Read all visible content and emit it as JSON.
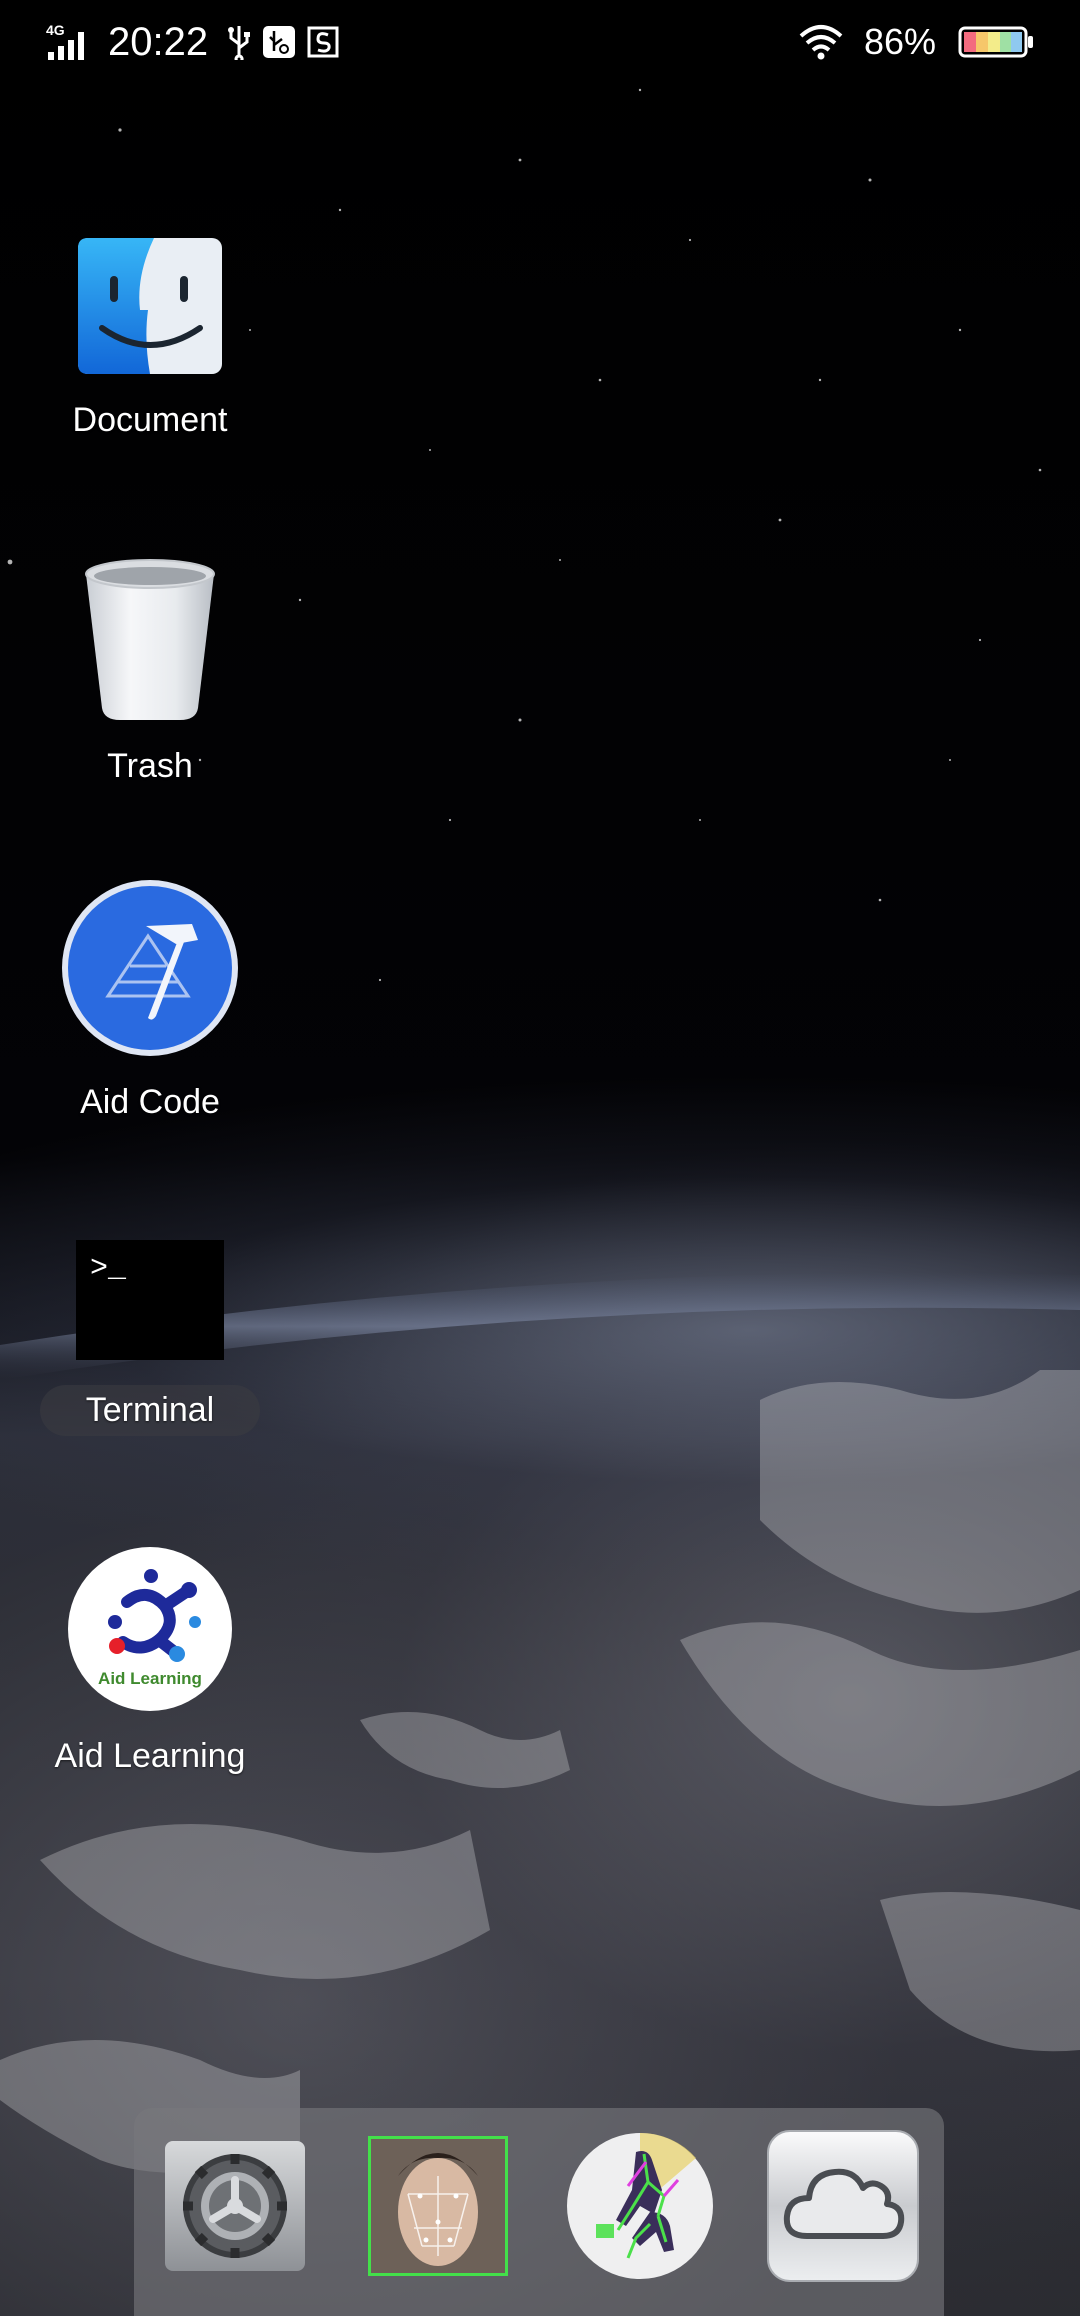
{
  "status_bar": {
    "network": "4G",
    "time": "20:22",
    "battery_percent": "86%"
  },
  "desktop": {
    "icons": [
      {
        "label": "Document",
        "icon": "finder-icon"
      },
      {
        "label": "Trash",
        "icon": "trash-icon"
      },
      {
        "label": "Aid Code",
        "icon": "xcode-icon"
      },
      {
        "label": "Terminal",
        "icon": "terminal-icon",
        "prompt": ">_"
      },
      {
        "label": "Aid Learning",
        "icon": "aid-learning-icon",
        "logo_text": "Aid Learning"
      }
    ]
  },
  "dock": {
    "items": [
      {
        "icon": "system-preferences-gear-icon"
      },
      {
        "icon": "face-detection-icon"
      },
      {
        "icon": "pose-estimation-icon"
      },
      {
        "icon": "cloud-icon"
      }
    ]
  },
  "colors": {
    "finder_blue": "#1e8ff2",
    "aidcode_blue": "#2a6ae0",
    "dock_background": "#78787d"
  }
}
